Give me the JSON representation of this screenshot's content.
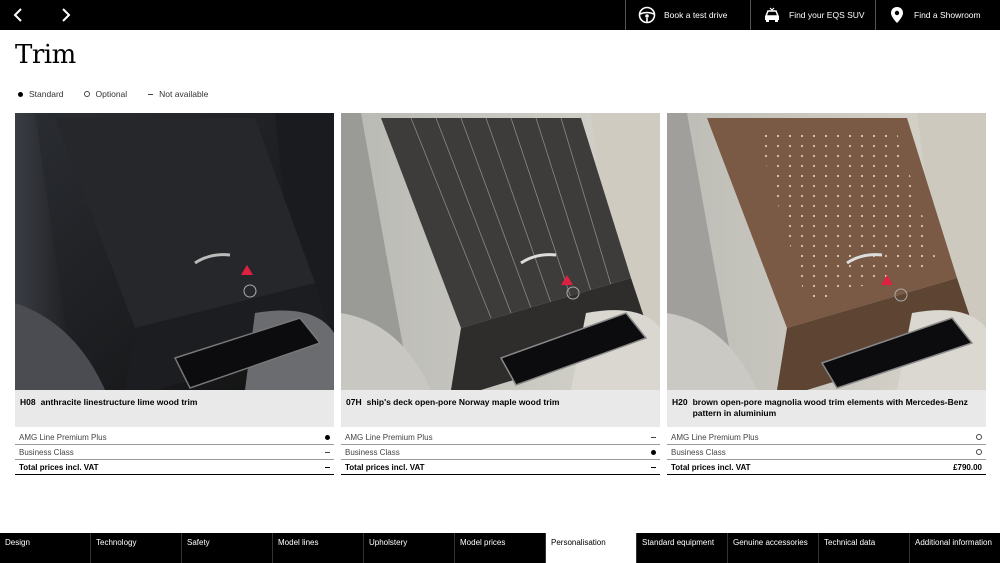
{
  "topbar": {
    "actions": [
      {
        "label": "Book a test drive",
        "icon": "steering-wheel-icon"
      },
      {
        "label": "Find your EQS SUV",
        "icon": "car-icon"
      },
      {
        "label": "Find a Showroom",
        "icon": "location-pin-icon"
      }
    ]
  },
  "page": {
    "title": "Trim"
  },
  "legend": [
    {
      "label": "Standard",
      "symbol": "filled-dot"
    },
    {
      "label": "Optional",
      "symbol": "hollow-ring"
    },
    {
      "label": "Not available",
      "symbol": "dash"
    }
  ],
  "cards": [
    {
      "code": "H08",
      "name": "anthracite linestructure lime wood trim",
      "rows": [
        {
          "label": "AMG Line Premium Plus",
          "value": "standard"
        },
        {
          "label": "Business Class",
          "value": "not-available"
        }
      ],
      "total_label": "Total prices incl. VAT",
      "total_value": "",
      "total_symbol": "not-available"
    },
    {
      "code": "07H",
      "name": "ship's deck open-pore Norway maple wood trim",
      "rows": [
        {
          "label": "AMG Line Premium Plus",
          "value": "not-available"
        },
        {
          "label": "Business Class",
          "value": "standard"
        }
      ],
      "total_label": "Total prices incl. VAT",
      "total_value": "",
      "total_symbol": "not-available"
    },
    {
      "code": "H20",
      "name": "brown open-pore magnolia wood trim elements with Mercedes-Benz pattern in aluminium",
      "rows": [
        {
          "label": "AMG Line Premium Plus",
          "value": "optional"
        },
        {
          "label": "Business Class",
          "value": "optional"
        }
      ],
      "total_label": "Total prices incl. VAT",
      "total_value": "£790.00",
      "total_symbol": ""
    }
  ],
  "bottom_nav": [
    {
      "label": "Design"
    },
    {
      "label": "Technology"
    },
    {
      "label": "Safety"
    },
    {
      "label": "Model lines"
    },
    {
      "label": "Upholstery"
    },
    {
      "label": "Model prices"
    },
    {
      "label": "Personalisation",
      "active": true
    },
    {
      "label": "Standard equipment"
    },
    {
      "label": "Genuine accessories"
    },
    {
      "label": "Technical data"
    },
    {
      "label": "Additional information"
    }
  ]
}
